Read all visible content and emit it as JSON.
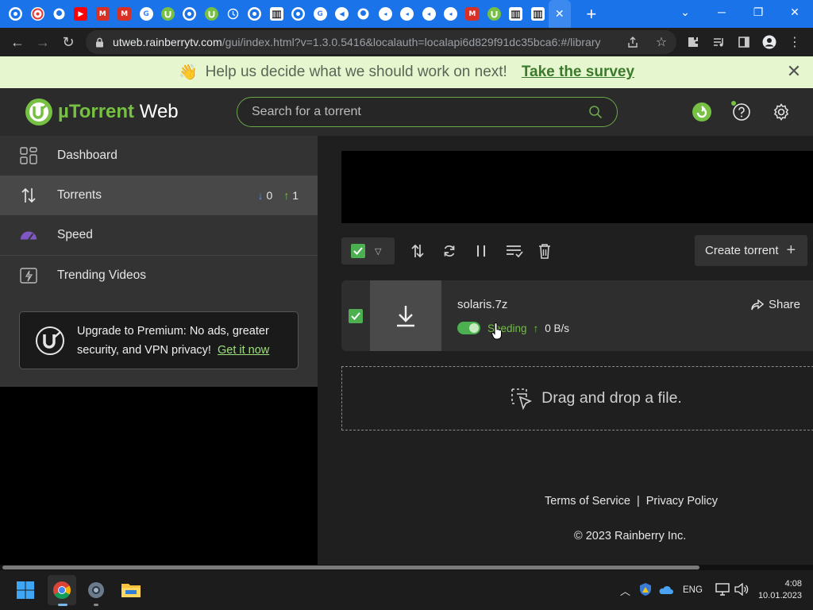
{
  "browser": {
    "tabs": [
      {
        "icon": "chrome-icon",
        "color": "#ffffff",
        "glyph": ""
      },
      {
        "icon": "target-icon",
        "color": "#e53935",
        "glyph": ""
      },
      {
        "icon": "github-icon",
        "color": "#ffffff",
        "glyph": ""
      },
      {
        "icon": "youtube-icon",
        "color": "#ff0000",
        "glyph": "▶"
      },
      {
        "icon": "gmail-icon",
        "color": "#d93025",
        "glyph": "M"
      },
      {
        "icon": "gmail-icon",
        "color": "#d93025",
        "glyph": "M"
      },
      {
        "icon": "google-icon",
        "color": "#ffffff",
        "glyph": "G"
      },
      {
        "icon": "utorrent-icon",
        "color": "#76c043",
        "glyph": ""
      },
      {
        "icon": "chrome-icon",
        "color": "#ffffff",
        "glyph": ""
      },
      {
        "icon": "utorrent-icon",
        "color": "#76c043",
        "glyph": ""
      },
      {
        "icon": "history-icon",
        "color": "#ffffff",
        "glyph": ""
      },
      {
        "icon": "chrome-icon",
        "color": "#ffffff",
        "glyph": ""
      },
      {
        "icon": "archive-icon",
        "color": "#ffffff",
        "glyph": ""
      },
      {
        "icon": "chrome-icon",
        "color": "#ffffff",
        "glyph": ""
      },
      {
        "icon": "google-icon",
        "color": "#ffffff",
        "glyph": "G"
      },
      {
        "icon": "speaker-icon",
        "color": "#ffffff",
        "glyph": "◀"
      },
      {
        "icon": "github-icon",
        "color": "#ffffff",
        "glyph": ""
      },
      {
        "icon": "telegram-icon",
        "color": "#ffffff",
        "glyph": "◂"
      },
      {
        "icon": "telegram-icon",
        "color": "#ffffff",
        "glyph": "◂"
      },
      {
        "icon": "telegram-icon",
        "color": "#ffffff",
        "glyph": "◂"
      },
      {
        "icon": "telegram-icon",
        "color": "#ffffff",
        "glyph": "◂"
      },
      {
        "icon": "gmail-icon",
        "color": "#d93025",
        "glyph": "M"
      },
      {
        "icon": "utorrent-icon",
        "color": "#76c043",
        "glyph": ""
      },
      {
        "icon": "archive-icon",
        "color": "#ffffff",
        "glyph": ""
      },
      {
        "icon": "archive-icon",
        "color": "#ffffff",
        "glyph": ""
      }
    ],
    "url_host": "utweb.rainberrytv.com",
    "url_path": "/gui/index.html?v=1.3.0.5416&localauth=localapi6d829f91dc35bca6:#/library"
  },
  "banner": {
    "emoji": "👋",
    "text": "Help us decide what we should work on next!",
    "link": "Take the survey"
  },
  "app": {
    "logo_mu": "µ",
    "logo_torrent": "Torrent",
    "logo_web": "Web",
    "search_placeholder": "Search for a torrent"
  },
  "sidebar": {
    "items": [
      {
        "label": "Dashboard"
      },
      {
        "label": "Torrents"
      },
      {
        "label": "Speed"
      },
      {
        "label": "Trending Videos"
      }
    ],
    "torrent_counts": {
      "down": "0",
      "up": "1"
    },
    "promo": {
      "text": "Upgrade to Premium: No ads, greater security, and VPN privacy!",
      "link": "Get it now"
    }
  },
  "main": {
    "create_label": "Create torrent",
    "torrent": {
      "name": "solaris.7z",
      "status": "Seeding",
      "rate": "0 B/s",
      "share_label": "Share"
    },
    "drop_text": "Drag and drop a file.",
    "footer": {
      "terms": "Terms of Service",
      "separator": "|",
      "privacy": "Privacy Policy",
      "copyright": "© 2023 Rainberry Inc."
    }
  },
  "taskbar": {
    "language": "ENG",
    "time": "4:08",
    "date": "10.01.2023"
  },
  "colors": {
    "accent_green": "#76c043",
    "browser_blue": "#1a73e8",
    "banner_bg": "#e6f7cf"
  }
}
